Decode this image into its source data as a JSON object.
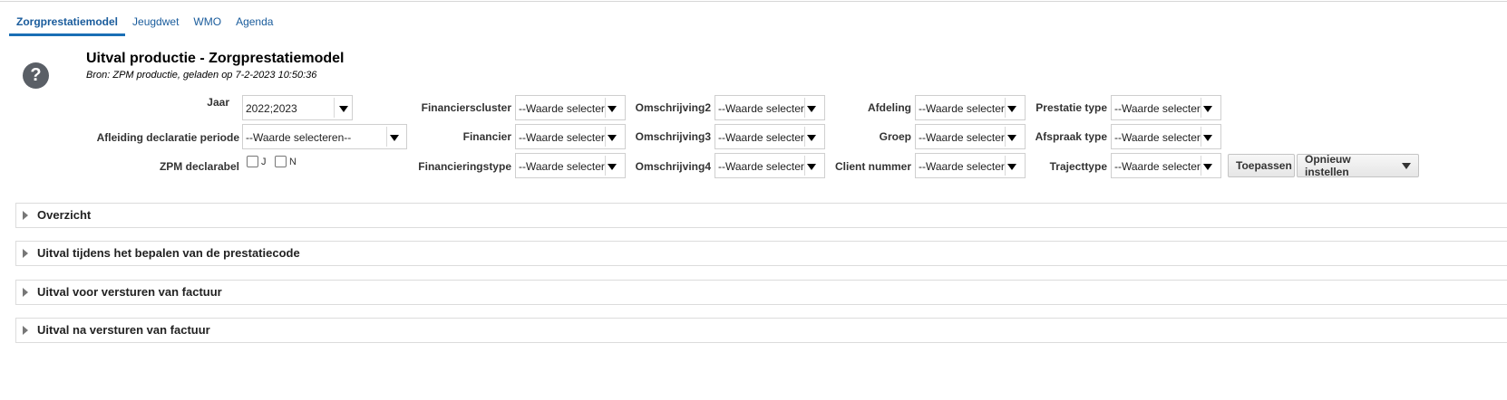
{
  "tabs": [
    {
      "label": "Zorgprestatiemodel",
      "active": true
    },
    {
      "label": "Jeugdwet",
      "active": false
    },
    {
      "label": "WMO",
      "active": false
    },
    {
      "label": "Agenda",
      "active": false
    }
  ],
  "header": {
    "title": "Uitval productie - Zorgprestatiemodel",
    "subtitle": "Bron: ZPM productie, geladen op 7-2-2023 10:50:36",
    "help_icon": "question-icon"
  },
  "filters": {
    "jaar": {
      "label": "Jaar",
      "value": "2022;2023"
    },
    "afleiding": {
      "label": "Afleiding declaratie periode",
      "value": "--Waarde selecteren--"
    },
    "zpm_declarabel": {
      "label": "ZPM declarabel",
      "option_j": "J",
      "option_n": "N"
    },
    "financierscluster": {
      "label": "Financierscluster",
      "value": "--Waarde selecteren--"
    },
    "financier": {
      "label": "Financier",
      "value": "--Waarde selecteren--"
    },
    "financieringstype": {
      "label": "Financieringstype",
      "value": "--Waarde selecteren--"
    },
    "omschrijving2": {
      "label": "Omschrijving2",
      "value": "--Waarde selecteren--"
    },
    "omschrijving3": {
      "label": "Omschrijving3",
      "value": "--Waarde selecteren--"
    },
    "omschrijving4": {
      "label": "Omschrijving4",
      "value": "--Waarde selecteren--"
    },
    "afdeling": {
      "label": "Afdeling",
      "value": "--Waarde selecteren--"
    },
    "groep": {
      "label": "Groep",
      "value": "--Waarde selecteren--"
    },
    "client_nummer": {
      "label": "Client nummer",
      "value": "--Waarde selecteren--"
    },
    "prestatie_type": {
      "label": "Prestatie type",
      "value": "--Waarde selecteren--"
    },
    "afspraak_type": {
      "label": "Afspraak type",
      "value": "--Waarde selecteren--"
    },
    "trajecttype": {
      "label": "Trajecttype",
      "value": "--Waarde selecteren--"
    }
  },
  "buttons": {
    "apply": "Toepassen",
    "reset": "Opnieuw instellen"
  },
  "sections": [
    "Overzicht",
    "Uitval tijdens het bepalen van de prestatiecode",
    "Uitval voor versturen van factuur",
    "Uitval na versturen van factuur"
  ]
}
